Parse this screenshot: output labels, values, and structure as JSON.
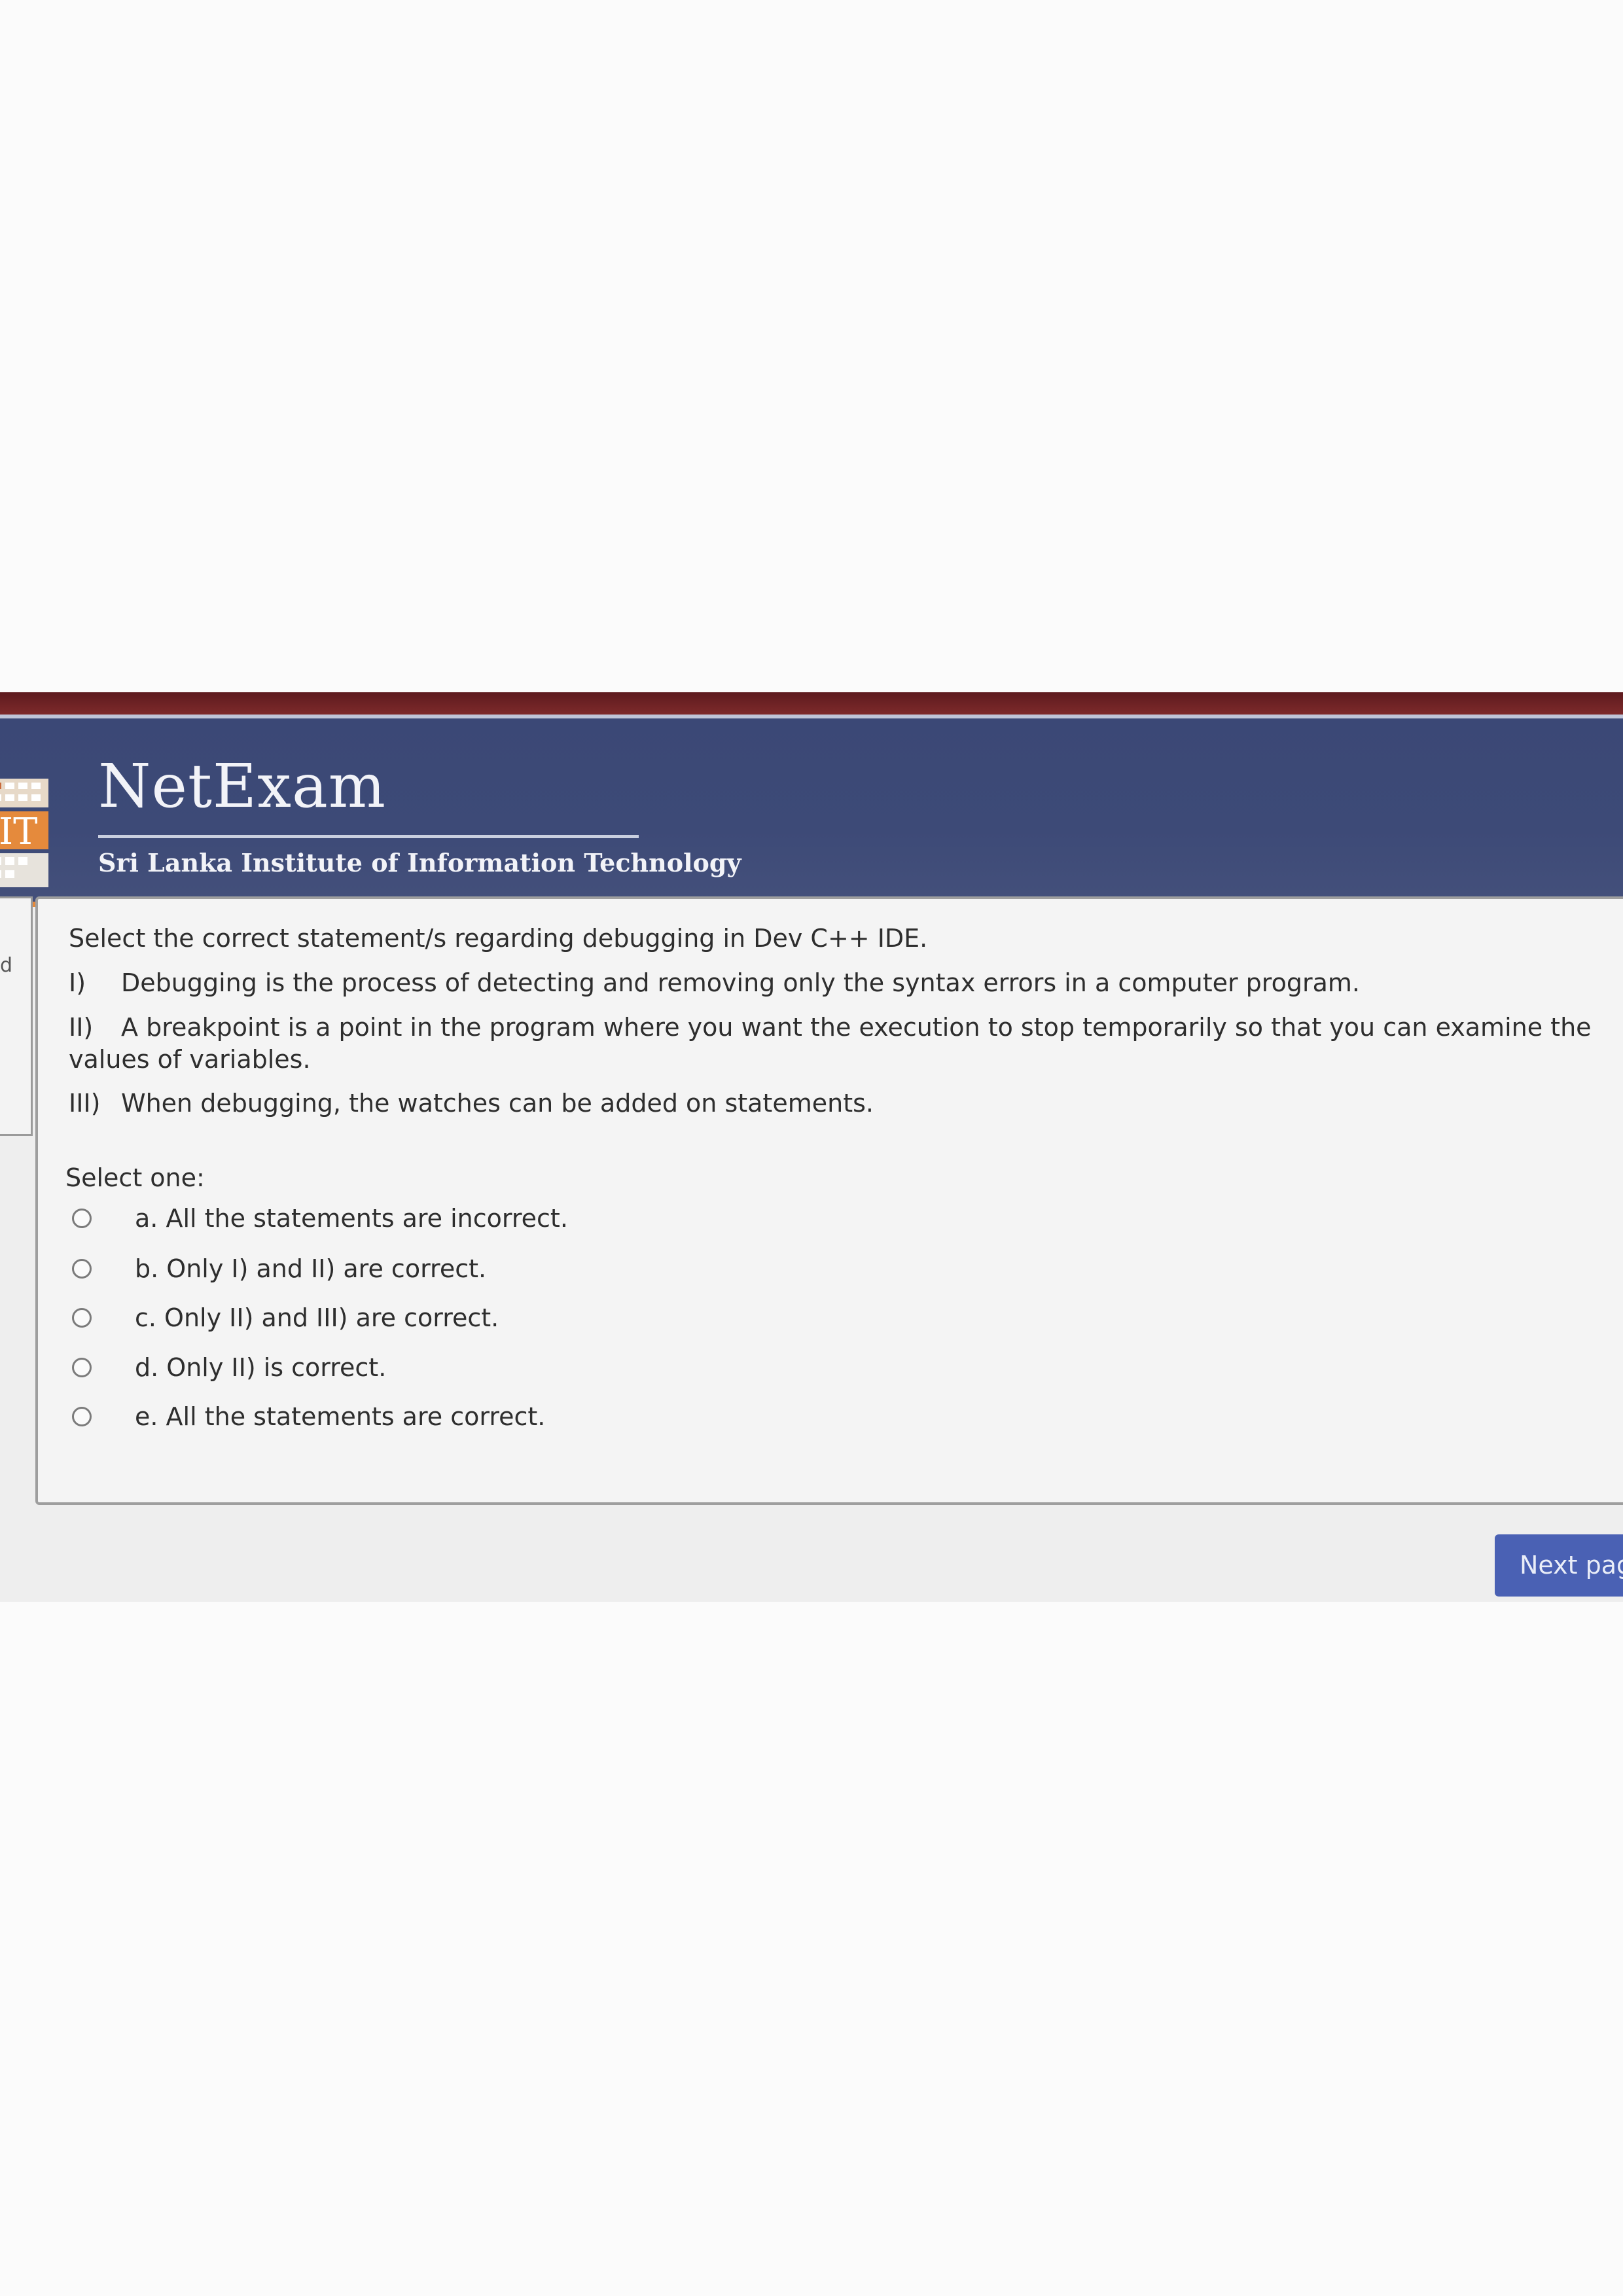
{
  "header": {
    "brand": "NetExam",
    "subtitle": "Sri Lanka Institute of Information Technology",
    "logo_text": "IT"
  },
  "side_panel": {
    "mark": "d"
  },
  "question": {
    "stem": "Select the correct statement/s regarding debugging in Dev C++ IDE.",
    "statements": [
      {
        "num": "I)",
        "text": "Debugging is the process of detecting and removing only the syntax errors  in a computer program."
      },
      {
        "num": "II)",
        "text": "A breakpoint is a point in the program where you want the execution to stop temporarily so that you can examine the values of variables."
      },
      {
        "num": "III)",
        "text": "When debugging, the watches can be added on statements."
      }
    ],
    "select_prompt": "Select one:",
    "options": [
      {
        "label": "a. All the statements are incorrect.",
        "selected": false
      },
      {
        "label": "b. Only I) and II) are correct.",
        "selected": false
      },
      {
        "label": "c. Only II) and III) are correct.",
        "selected": false
      },
      {
        "label": "d. Only II) is  correct.",
        "selected": false
      },
      {
        "label": "e. All the statements are correct.",
        "selected": false
      }
    ]
  },
  "footer": {
    "next_label": "Next page"
  },
  "colors": {
    "header": "#3b4876",
    "accent_orange": "#e58a3c",
    "button": "#4a61b4"
  }
}
